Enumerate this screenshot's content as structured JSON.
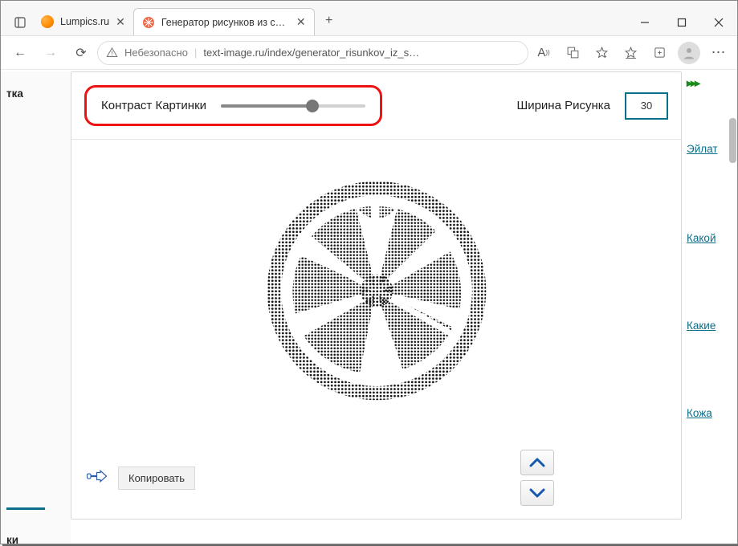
{
  "window": {
    "tabs": [
      {
        "label": "Lumpics.ru",
        "active": false
      },
      {
        "label": "Генератор рисунков из символ",
        "active": true
      }
    ],
    "newtab_tooltip": "+"
  },
  "addressbar": {
    "security_label": "Небезопасно",
    "url": "text-image.ru/index/generator_risunkov_iz_s…"
  },
  "left_sidebar": {
    "frag1": "тка",
    "frag2": "ки"
  },
  "controls": {
    "contrast_label": "Контраст Картинки",
    "contrast_value": 62,
    "width_label": "Ширина Рисунка",
    "width_value": "30"
  },
  "actions": {
    "copy_label": "Копировать"
  },
  "right_sidebar": {
    "chevrons": "▸▸▸",
    "links": [
      "Эйлат",
      "Какой",
      "Какие",
      "Кожа"
    ]
  }
}
